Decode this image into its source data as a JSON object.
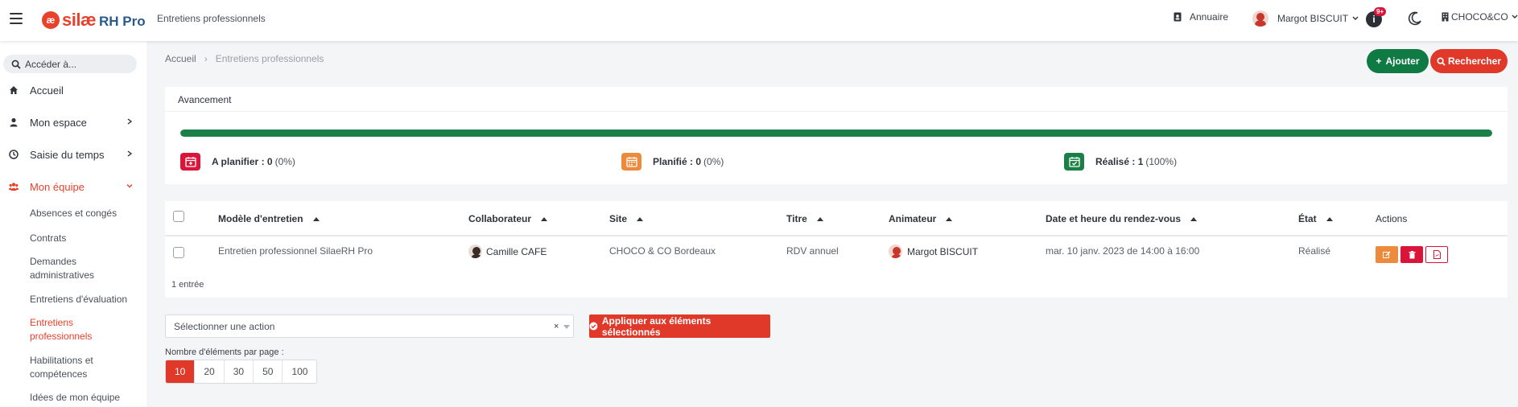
{
  "header": {
    "logo_silae": "silæ",
    "logo_rh": "RH Pro",
    "page_name": "Entretiens professionnels",
    "directory_label": "Annuaire",
    "user_name": "Margot BISCUIT",
    "notif_badge": "9+",
    "company": "CHOCO&CO"
  },
  "sidebar": {
    "search_placeholder": "Accéder à...",
    "items": [
      {
        "label": "Accueil",
        "icon": "home-icon"
      },
      {
        "label": "Mon espace",
        "icon": "user-icon"
      },
      {
        "label": "Saisie du temps",
        "icon": "clock-icon"
      },
      {
        "label": "Mon équipe",
        "icon": "users-icon"
      }
    ],
    "sub_items": [
      {
        "label": "Absences et congés"
      },
      {
        "label": "Contrats"
      },
      {
        "label": "Demandes administratives"
      },
      {
        "label": "Entretiens d'évaluation"
      },
      {
        "label": "Entretiens professionnels"
      },
      {
        "label": "Habilitations et compétences"
      },
      {
        "label": "Idées de mon équipe"
      }
    ]
  },
  "breadcrumb": {
    "home": "Accueil",
    "current": "Entretiens professionnels"
  },
  "actions": {
    "add": "Ajouter",
    "search": "Rechercher"
  },
  "progress_card": {
    "title": "Avancement",
    "progress_fraction": 1.0,
    "stats": [
      {
        "label": "A planifier :",
        "count": "0",
        "pct": "(0%)",
        "color": "#d9163a"
      },
      {
        "label": "Planifié :",
        "count": "0",
        "pct": "(0%)",
        "color": "#ee8a3c"
      },
      {
        "label": "Réalisé :",
        "count": "1",
        "pct": "(100%)",
        "color": "#1a8048"
      }
    ]
  },
  "table": {
    "columns": [
      "Modèle d'entretien",
      "Collaborateur",
      "Site",
      "Titre",
      "Animateur",
      "Date et heure du rendez-vous",
      "État",
      "Actions"
    ],
    "rows": [
      {
        "model": "Entretien professionnel SilaeRH Pro",
        "collaborator": "Camille CAFE",
        "site": "CHOCO & CO Bordeaux",
        "title": "RDV annuel",
        "animator": "Margot BISCUIT",
        "datetime": "mar. 10 janv. 2023 de 14:00 à 16:00",
        "state": "Réalisé"
      }
    ],
    "entries": "1 entrée"
  },
  "bulk": {
    "select_placeholder": "Sélectionner une action",
    "clear": "×",
    "apply": "Appliquer aux éléments sélectionnés"
  },
  "pagination": {
    "label": "Nombre d'éléments par page :",
    "options": [
      "10",
      "20",
      "30",
      "50",
      "100"
    ],
    "selected": "10"
  },
  "colors": {
    "brand": "#e8412c",
    "success": "#0f7a43",
    "danger": "#d9163a",
    "warning": "#ee8a3c"
  }
}
